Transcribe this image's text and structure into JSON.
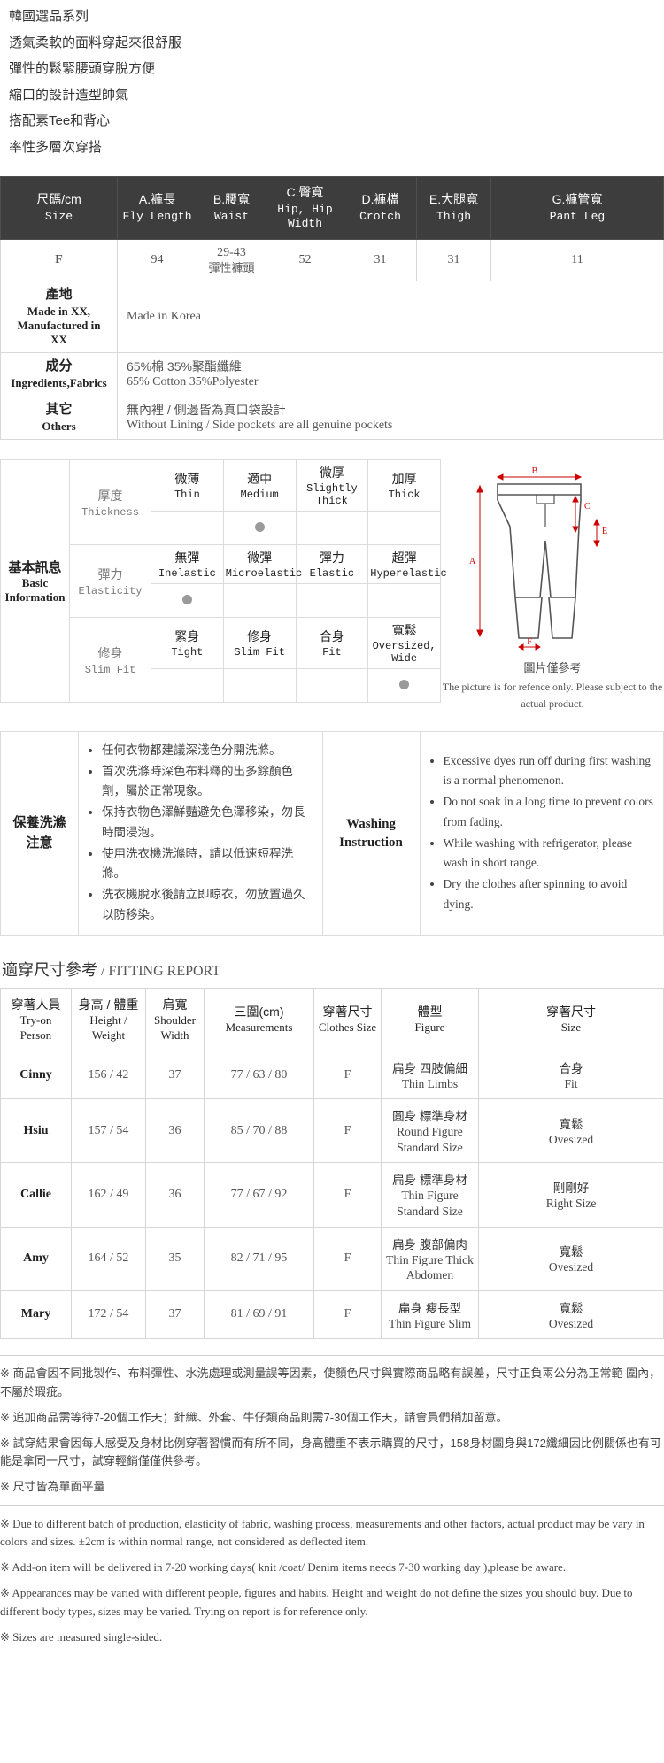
{
  "intro_lines": [
    "韓國選品系列",
    "透氣柔軟的面料穿起來很舒服",
    "彈性的鬆緊腰頭穿脫方便",
    "縮口的設計造型帥氣",
    "搭配素Tee和背心",
    "率性多層次穿搭"
  ],
  "size_table": {
    "headers": [
      {
        "cn": "尺碼/cm",
        "en": "Size"
      },
      {
        "cn": "A.褲長",
        "en": "Fly Length"
      },
      {
        "cn": "B.腰寬",
        "en": "Waist"
      },
      {
        "cn": "C.臀寬",
        "en": "Hip, Hip Width"
      },
      {
        "cn": "D.褲檔",
        "en": "Crotch"
      },
      {
        "cn": "E.大腿寬",
        "en": "Thigh"
      },
      {
        "cn": "G.褲管寬",
        "en": "Pant Leg"
      }
    ],
    "row": {
      "size": "F",
      "fly_length": "94",
      "waist": "29-43",
      "waist_note": "彈性褲頭",
      "hip": "52",
      "crotch": "31",
      "thigh": "31",
      "pant_leg": "11"
    },
    "info_rows": [
      {
        "label_cn": "產地",
        "label_en": "Made in XX, Manufactured in XX",
        "value_cn": "",
        "value_en": "Made in Korea"
      },
      {
        "label_cn": "成分",
        "label_en": "Ingredients,Fabrics",
        "value_cn": "65%棉 35%聚酯纖維",
        "value_en": "65% Cotton 35%Polyester"
      },
      {
        "label_cn": "其它",
        "label_en": "Others",
        "value_cn": "無內裡 / 側邊皆為真口袋設計",
        "value_en": "Without Lining / Side pockets are all genuine pockets"
      }
    ]
  },
  "basic_info": {
    "section_cn": "基本訊息",
    "section_en": "Basic Information",
    "rows": [
      {
        "cat_cn": "厚度",
        "cat_en": "Thickness",
        "options": [
          {
            "cn": "微薄",
            "en": "Thin"
          },
          {
            "cn": "適中",
            "en": "Medium"
          },
          {
            "cn": "微厚",
            "en": "Slightly Thick"
          },
          {
            "cn": "加厚",
            "en": "Thick"
          }
        ],
        "selected_index": 1
      },
      {
        "cat_cn": "彈力",
        "cat_en": "Elasticity",
        "options": [
          {
            "cn": "無彈",
            "en": "Inelastic"
          },
          {
            "cn": "微彈",
            "en": "Microelastic"
          },
          {
            "cn": "彈力",
            "en": "Elastic"
          },
          {
            "cn": "超彈",
            "en": "Hyperelastic"
          }
        ],
        "selected_index": 0
      },
      {
        "cat_cn": "修身",
        "cat_en": "Slim Fit",
        "options": [
          {
            "cn": "緊身",
            "en": "Tight"
          },
          {
            "cn": "修身",
            "en": "Slim Fit"
          },
          {
            "cn": "合身",
            "en": "Fit"
          },
          {
            "cn": "寬鬆",
            "en": "Oversized, Wide"
          }
        ],
        "selected_index": 3
      }
    ],
    "diagram": {
      "labels": [
        "A",
        "B",
        "C",
        "E",
        "F"
      ],
      "note_cn": "圖片僅參考",
      "note_en": "The picture is for refence only. Please subject to the actual product."
    }
  },
  "washing": {
    "label_cn": "保養洗滌注意",
    "label_en": "Washing Instruction",
    "items_cn": [
      "任何衣物都建議深淺色分開洗滌。",
      "首次洗滌時深色布料釋的出多餘顏色劑，屬於正常現象。",
      "保持衣物色澤鮮豔避免色澤移染，勿長時間浸泡。",
      "使用洗衣機洗滌時，請以低速短程洗滌。",
      "洗衣機脫水後請立即晾衣，勿放置過久以防移染。"
    ],
    "items_en": [
      "Excessive dyes run off during first washing is a normal phenomenon.",
      "Do not soak in a long time to prevent colors from fading.",
      "While washing with refrigerator, please wash in short range.",
      "Dry the clothes after spinning to avoid dying."
    ]
  },
  "fitting_report": {
    "title_cn": "適穿尺寸參考",
    "title_en": "/ FITTING REPORT",
    "headers": [
      {
        "cn": "穿著人員",
        "en": "Try-on Person"
      },
      {
        "cn": "身高 / 體重",
        "en": "Height / Weight"
      },
      {
        "cn": "肩寬",
        "en": "Shoulder Width"
      },
      {
        "cn": "三圍(cm)",
        "en": "Measurements"
      },
      {
        "cn": "穿著尺寸",
        "en": "Clothes Size"
      },
      {
        "cn": "體型",
        "en": "Figure"
      },
      {
        "cn": "穿著尺寸",
        "en": "Size"
      }
    ],
    "rows": [
      {
        "name": "Cinny",
        "hw": "156 / 42",
        "shoulder": "37",
        "measurements": "77 / 63 / 80",
        "clothes_size": "F",
        "figure_cn": "扁身 四肢偏細",
        "figure_en": "Thin Limbs",
        "size_cn": "合身",
        "size_en": "Fit"
      },
      {
        "name": "Hsiu",
        "hw": "157 / 54",
        "shoulder": "36",
        "measurements": "85 / 70 / 88",
        "clothes_size": "F",
        "figure_cn": "圓身 標準身材",
        "figure_en": "Round Figure Standard Size",
        "size_cn": "寬鬆",
        "size_en": "Ovesized"
      },
      {
        "name": "Callie",
        "hw": "162 / 49",
        "shoulder": "36",
        "measurements": "77 / 67 / 92",
        "clothes_size": "F",
        "figure_cn": "扁身 標準身材",
        "figure_en": "Thin Figure Standard Size",
        "size_cn": "剛剛好",
        "size_en": "Right Size"
      },
      {
        "name": "Amy",
        "hw": "164 / 52",
        "shoulder": "35",
        "measurements": "82 / 71 / 95",
        "clothes_size": "F",
        "figure_cn": "扁身 腹部偏肉",
        "figure_en": "Thin Figure Thick Abdomen",
        "size_cn": "寬鬆",
        "size_en": "Ovesized"
      },
      {
        "name": "Mary",
        "hw": "172 / 54",
        "shoulder": "37",
        "measurements": "81 / 69 / 91",
        "clothes_size": "F",
        "figure_cn": "扁身 瘦長型",
        "figure_en": "Thin Figure Slim",
        "size_cn": "寬鬆",
        "size_en": "Ovesized"
      }
    ]
  },
  "notes": {
    "cn": [
      "※ 商品會因不同批製作、布料彈性、水洗處理或測量誤等因素，使顏色尺寸與實際商品略有誤差，尺寸正負兩公分為正常範 圍內，不屬於瑕疵。",
      "※ 追加商品需等待7-20個工作天；針織、外套、牛仔類商品則需7-30個工作天，請會員們稍加留意。",
      "※ 試穿結果會因每人感受及身材比例穿著習慣而有所不同，身高體重不表示購買的尺寸，158身材圖身與172纖細因比例關係也有可能是拿同一尺寸，試穿輕銷僅僅供參考。",
      "※ 尺寸皆為單面平量"
    ],
    "en": [
      "※ Due to different batch of production, elasticity of fabric, washing process, measurements and other factors, actual product may be vary in colors and sizes. ±2cm is within normal range, not considered as deflected item.",
      "※ Add-on item will be delivered in 7-20 working days( knit /coat/ Denim items needs 7-30 working day ),please be aware.",
      "※ Appearances may be varied with different people, figures and habits. Height and weight do not define the sizes you should buy. Due to different body types, sizes may be varied. Trying on report is for reference only.",
      "※ Sizes are measured single-sided."
    ]
  }
}
